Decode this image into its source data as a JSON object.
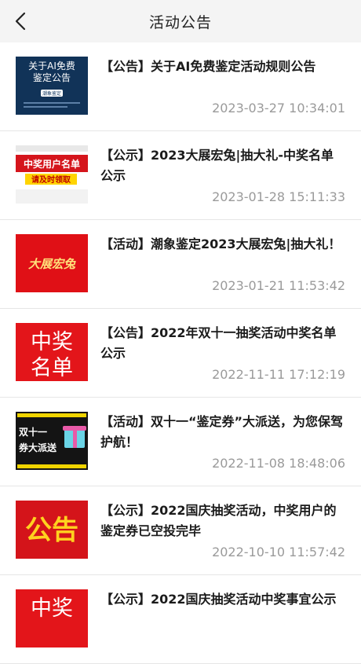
{
  "header": {
    "title": "活动公告"
  },
  "items": [
    {
      "title": "【公告】关于AI免费鉴定活动规则公告",
      "date": "2023-03-27 10:34:01",
      "thumb": {
        "line1": "关于AI免费",
        "line2": "鉴定公告",
        "badge": "潮象鉴定"
      }
    },
    {
      "title": "【公示】2023大展宏兔|抽大礼-中奖名单公示",
      "date": "2023-01-28 15:11:33",
      "thumb": {
        "line1": "中奖用户名单",
        "line2": "请及时领取"
      }
    },
    {
      "title": "【活动】潮象鉴定2023大展宏兔|抽大礼！",
      "date": "2023-01-21 11:53:42",
      "thumb": {
        "line1": "大展宏兔"
      }
    },
    {
      "title": "【公告】2022年双十一抽奖活动中奖名单公示",
      "date": "2022-11-11 17:12:19",
      "thumb": {
        "line1": "中奖",
        "line2": "名单"
      }
    },
    {
      "title": "【活动】双十一“鉴定券”大派送，为您保驾护航！",
      "date": "2022-11-08 18:48:06",
      "thumb": {
        "line1": "双十一",
        "line2": "券大派送"
      }
    },
    {
      "title": "【公示】2022国庆抽奖活动，中奖用户的鉴定券已空投完毕",
      "date": "2022-10-10 11:57:42",
      "thumb": {
        "line1": "公告"
      }
    },
    {
      "title": "【公示】2022国庆抽奖活动中奖事宜公示",
      "date": "",
      "thumb": {
        "line1": "中奖"
      }
    }
  ]
}
